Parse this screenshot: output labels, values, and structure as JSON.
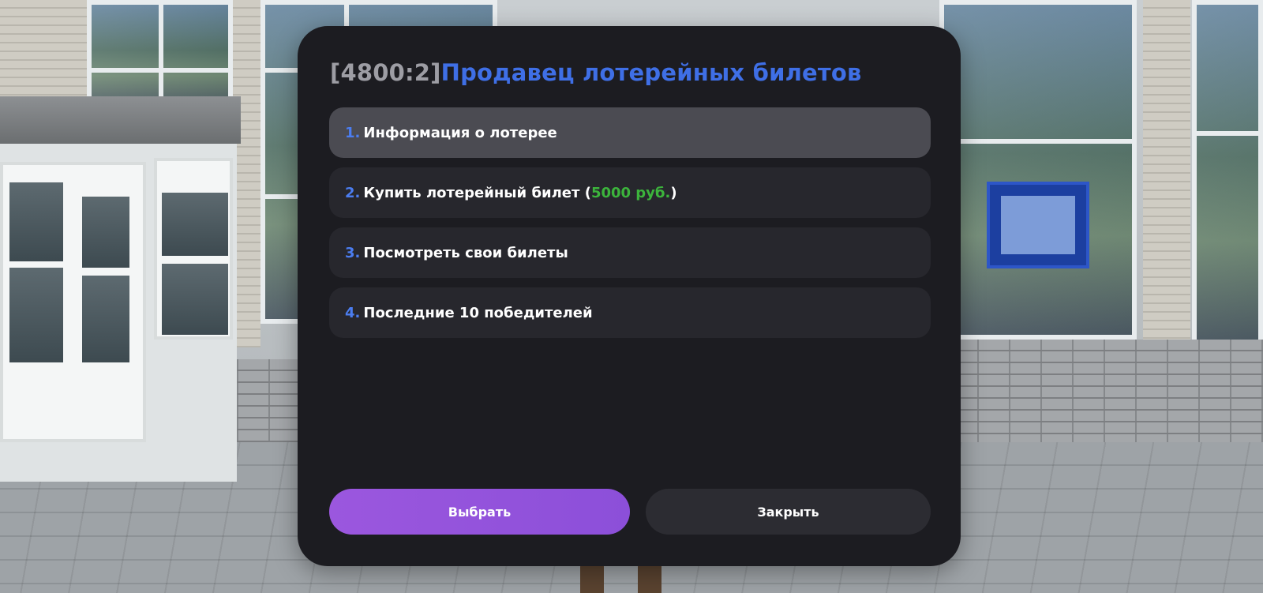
{
  "dialog": {
    "title_id": "[4800:2]",
    "title_name": "Продавец лотерейных билетов",
    "options": [
      {
        "number": "1.",
        "label": "Информация о лотерее",
        "selected": true
      },
      {
        "number": "2.",
        "label_before": "Купить лотерейный билет (",
        "price": "5000 руб.",
        "label_after": ")",
        "selected": false
      },
      {
        "number": "3.",
        "label": "Посмотреть свои билеты",
        "selected": false
      },
      {
        "number": "4.",
        "label": "Последние 10 победителей",
        "selected": false
      }
    ],
    "select_button": "Выбрать",
    "close_button": "Закрыть"
  },
  "colors": {
    "accent_blue": "#3f6fe6",
    "price_green": "#3cb43c",
    "select_purple": "#9b57de",
    "panel_bg": "#1c1c21",
    "selected_row": "#4b4b52"
  }
}
